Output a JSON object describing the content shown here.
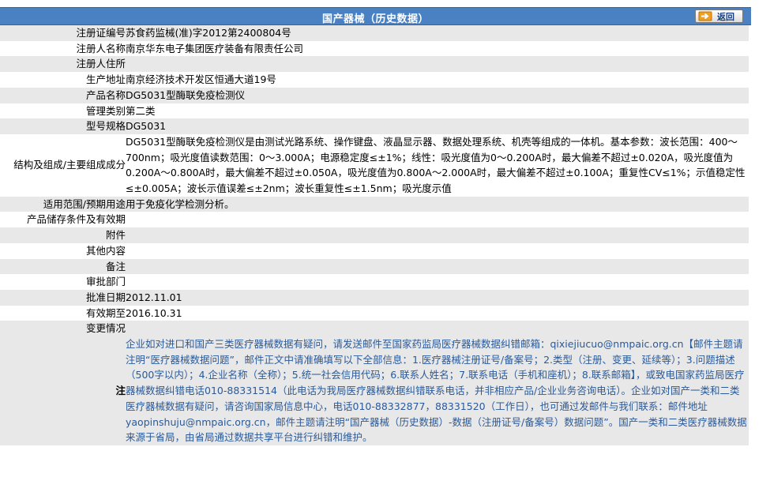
{
  "header": {
    "title": "国产器械（历史数据）",
    "back_label": "返回"
  },
  "rows": [
    {
      "label": "注册证编号",
      "value": "苏食药监械(准)字2012第2400804号"
    },
    {
      "label": "注册人名称",
      "value": "南京华东电子集团医疗装备有限责任公司"
    },
    {
      "label": "注册人住所",
      "value": ""
    },
    {
      "label": "生产地址",
      "value": "南京经济技术开发区恒通大道19号"
    },
    {
      "label": "产品名称",
      "value": "DG5031型酶联免疫检测仪"
    },
    {
      "label": "管理类别",
      "value": "第二类"
    },
    {
      "label": "型号规格",
      "value": "DG5031"
    },
    {
      "label": "结构及组成/主要组成成分",
      "value": "DG5031型酶联免疫检测仪是由测试光路系统、操作键盘、液晶显示器、数据处理系统、机壳等组成的一体机。基本参数：波长范围：400～700nm；吸光度值读数范围：0～3.000A；电源稳定度≤±1%；线性：吸光度值为0～0.200A时，最大偏差不超过±0.020A，吸光度值为0.200A～0.800A时，最大偏差不超过±0.050A，吸光度值为0.800A～2.000A时，最大偏差不超过±0.100A；重复性CV≤1%；示值稳定性≤±0.005A；波长示值误差≤±2nm；波长重复性≤±1.5nm；吸光度示值"
    },
    {
      "label": "适用范围/预期用途",
      "value": "用于免疫化学检测分析。"
    },
    {
      "label": "产品储存条件及有效期",
      "value": ""
    },
    {
      "label": "附件",
      "value": ""
    },
    {
      "label": "其他内容",
      "value": ""
    },
    {
      "label": "备注",
      "value": ""
    },
    {
      "label": "审批部门",
      "value": ""
    },
    {
      "label": "批准日期",
      "value": "2012.11.01"
    },
    {
      "label": "有效期至",
      "value": "2016.10.31"
    },
    {
      "label": "变更情况",
      "value": ""
    }
  ],
  "note": {
    "label": "注",
    "text": "企业如对进口和国产三类医疗器械数据有疑问，请发送邮件至国家药监局医疗器械数据纠错邮箱：qixiejiucuo@nmpaic.org.cn【邮件主题请注明“医疗器械数据问题”，邮件正文中请准确填写以下全部信息：1.医疗器械注册证号/备案号；2.类型（注册、变更、延续等）；3.问题描述（500字以内）；4.企业名称（全称）；5.统一社会信用代码；6.联系人姓名；7.联系电话（手机和座机）；8.联系邮箱】，或致电国家药监局医疗器械数据纠错电话010-88331514（此电话为我局医疗器械数据纠错联系电话，并非相应产品/企业业务咨询电话）。企业如对国产一类和二类医疗器械数据有疑问，请咨询国家局信息中心，电话010-88332877，88331520（工作日），也可通过发邮件与我们联系：邮件地址yaopinshuju@nmpaic.org.cn，邮件主题请注明“国产器械（历史数据）-数据（注册证号/备案号）数据问题”。国产一类和二类医疗器械数据来源于省局，由省局通过数据共享平台进行纠错和维护。"
  },
  "colors": {
    "header_bg": "#4a81c3",
    "row_alt_bg": "#e8e8e8",
    "note_text": "#2a5a9a"
  }
}
